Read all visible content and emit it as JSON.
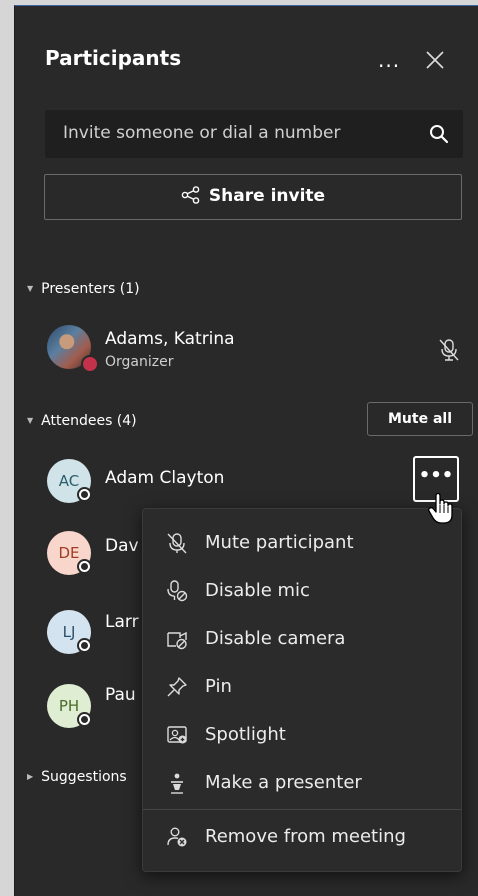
{
  "panel": {
    "title": "Participants",
    "more": "...",
    "close_icon": "close-icon"
  },
  "search": {
    "placeholder": "Invite someone or dial a number",
    "icon": "search-icon"
  },
  "share": {
    "label": "Share invite",
    "icon": "share-icon"
  },
  "presenters": {
    "header": "Presenters (1)",
    "members": [
      {
        "name": "Adams, Katrina",
        "role": "Organizer",
        "status_color": "#c4314b",
        "muted": true
      }
    ]
  },
  "attendees": {
    "header": "Attendees (4)",
    "mute_all": "Mute all",
    "members": [
      {
        "initials": "AC",
        "name": "Adam Clayton",
        "color": "#cfe3e8",
        "text_color": "#2c5d6b"
      },
      {
        "initials": "DE",
        "name": "Dav",
        "color": "#f9d6cc",
        "text_color": "#a13d22"
      },
      {
        "initials": "LJ",
        "name": "Larr",
        "color": "#d3e4f0",
        "text_color": "#2c4f6b"
      },
      {
        "initials": "PH",
        "name": "Pau",
        "color": "#dfedd3",
        "text_color": "#4a6b2c"
      }
    ],
    "row_more": "•••"
  },
  "suggestions": {
    "header": "Suggestions"
  },
  "context_menu": {
    "items": [
      {
        "label": "Mute participant",
        "icon": "mic-off-icon"
      },
      {
        "label": "Disable mic",
        "icon": "disable-mic-icon"
      },
      {
        "label": "Disable camera",
        "icon": "disable-camera-icon"
      },
      {
        "label": "Pin",
        "icon": "pin-icon"
      },
      {
        "label": "Spotlight",
        "icon": "spotlight-icon"
      },
      {
        "label": "Make a presenter",
        "icon": "presenter-icon"
      },
      {
        "label": "Remove from meeting",
        "icon": "remove-person-icon"
      }
    ]
  },
  "colors": {
    "panel_bg": "#292929",
    "accent_border": "#3b63a6"
  }
}
